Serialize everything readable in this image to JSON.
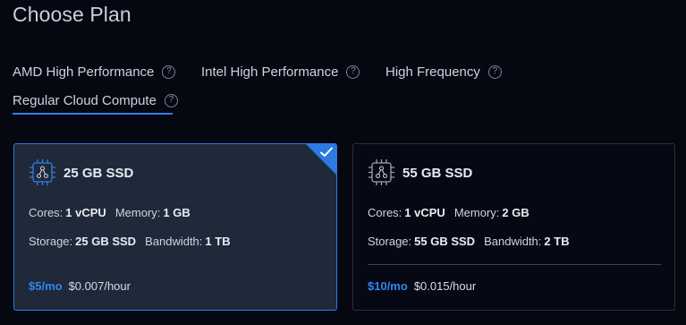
{
  "page": {
    "title": "Choose Plan"
  },
  "tabs": [
    {
      "label": "AMD High Performance",
      "help": "?"
    },
    {
      "label": "Intel High Performance",
      "help": "?"
    },
    {
      "label": "High Frequency",
      "help": "?"
    },
    {
      "label": "Regular Cloud Compute",
      "help": "?",
      "active": true
    }
  ],
  "colors": {
    "accent": "#2f7fe6",
    "selected_card_bg": "#1f2939",
    "page_bg": "#050711"
  },
  "plans": [
    {
      "name": "25 GB SSD",
      "selected": true,
      "icon": "cpu-chip-icon",
      "cores_label": "Cores:",
      "cores": "1 vCPU",
      "memory_label": "Memory:",
      "memory": "1 GB",
      "storage_label": "Storage:",
      "storage": "25 GB SSD",
      "bandwidth_label": "Bandwidth:",
      "bandwidth": "1 TB",
      "price_month": "$5/mo",
      "price_hour": "$0.007/hour"
    },
    {
      "name": "55 GB SSD",
      "selected": false,
      "icon": "cpu-chip-icon",
      "cores_label": "Cores:",
      "cores": "1 vCPU",
      "memory_label": "Memory:",
      "memory": "2 GB",
      "storage_label": "Storage:",
      "storage": "55 GB SSD",
      "bandwidth_label": "Bandwidth:",
      "bandwidth": "2 TB",
      "price_month": "$10/mo",
      "price_hour": "$0.015/hour"
    }
  ]
}
